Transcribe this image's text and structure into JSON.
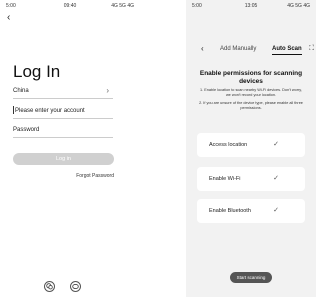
{
  "login_screen": {
    "status": {
      "left": "5:00",
      "middle": "09:40",
      "right": "4G 5G 4G"
    },
    "back_icon": "‹",
    "title": "Log In",
    "country": {
      "label": "China",
      "chevron": "›"
    },
    "account": {
      "placeholder": "Please enter your account"
    },
    "password": {
      "placeholder": "Password"
    },
    "login_button": "Log in",
    "forgot_password": "Forgot Password",
    "social_icons": [
      "wechat-icon",
      "chat-icon"
    ]
  },
  "scan_screen": {
    "status": {
      "left": "5:00",
      "middle": "13:05",
      "right": "4G 5G 4G"
    },
    "back_icon": "‹",
    "tabs": {
      "add_manually": "Add Manually",
      "auto_scan": "Auto Scan"
    },
    "scan_icon": "⛶",
    "permissions_title": "Enable permissions for scanning devices",
    "info_1": "1. Enable location to scan nearby Wi-Fi devices. Don't worry, we won't record your location.",
    "info_2": "2. If you are unsure of the device type, please enable all three permissions.",
    "permissions": [
      {
        "label": "Access location",
        "check": "✓"
      },
      {
        "label": "Enable Wi-Fi",
        "check": "✓"
      },
      {
        "label": "Enable Bluetooth",
        "check": "✓"
      }
    ],
    "start_button": "Start scanning"
  }
}
